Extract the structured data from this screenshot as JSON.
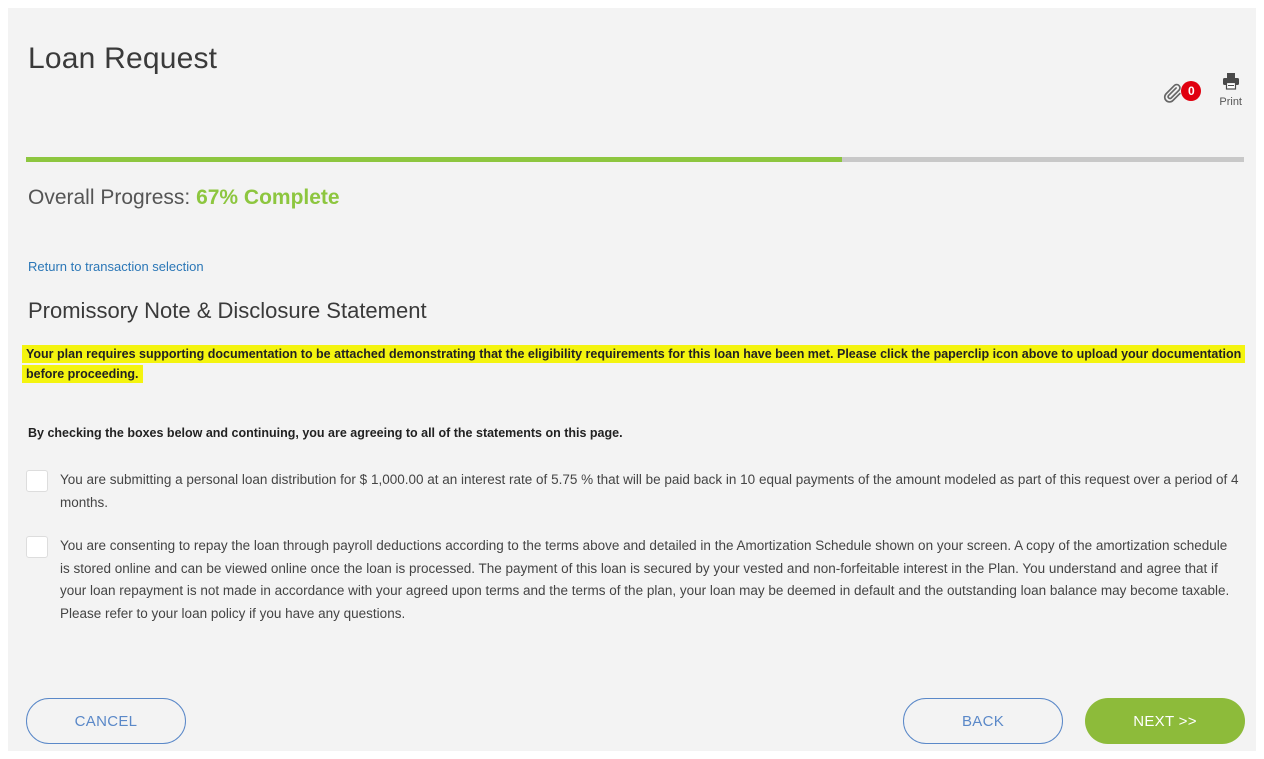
{
  "header": {
    "title": "Loan Request",
    "attachment_count": "0",
    "print_label": "Print"
  },
  "progress": {
    "label": "Overall Progress:",
    "value_text": "67% Complete",
    "fraction": 0.67
  },
  "nav": {
    "return_link": "Return to transaction selection"
  },
  "section": {
    "title": "Promissory Note & Disclosure Statement",
    "warning": "Your plan requires supporting documentation to be attached demonstrating that the eligibility requirements for this loan have been met. Please click the paperclip icon above to upload your documentation before proceeding.",
    "agreement_intro": "By checking the boxes below and continuing, you are agreeing to all of the statements on this page."
  },
  "statements": [
    {
      "checked": false,
      "text": "You are submitting a personal loan distribution for $ 1,000.00 at an interest rate of 5.75 % that will be paid back in 10 equal payments of the amount modeled as part of this request over a period of 4 months."
    },
    {
      "checked": false,
      "text": "You are consenting to repay the loan through payroll deductions according to the terms above and detailed in the Amortization Schedule shown on your screen. A copy of the amortization schedule is stored online and can be viewed online once the loan is processed. The payment of this loan is secured by your vested and non-forfeitable interest in the Plan. You understand and agree that if your loan repayment is not made in accordance with your agreed upon terms and the terms of the plan, your loan may be deemed in default and the outstanding loan balance may become taxable. Please refer to your loan policy if you have any questions."
    }
  ],
  "buttons": {
    "cancel": "CANCEL",
    "back": "BACK",
    "next": "NEXT >>"
  },
  "colors": {
    "accent_green": "#8dc63f",
    "button_blue": "#5a88c8",
    "badge_red": "#e0000f",
    "highlight_yellow": "#f4f40f",
    "link_blue": "#2b77b7"
  },
  "icons": {
    "attachment": "paperclip-icon",
    "print": "printer-icon"
  }
}
